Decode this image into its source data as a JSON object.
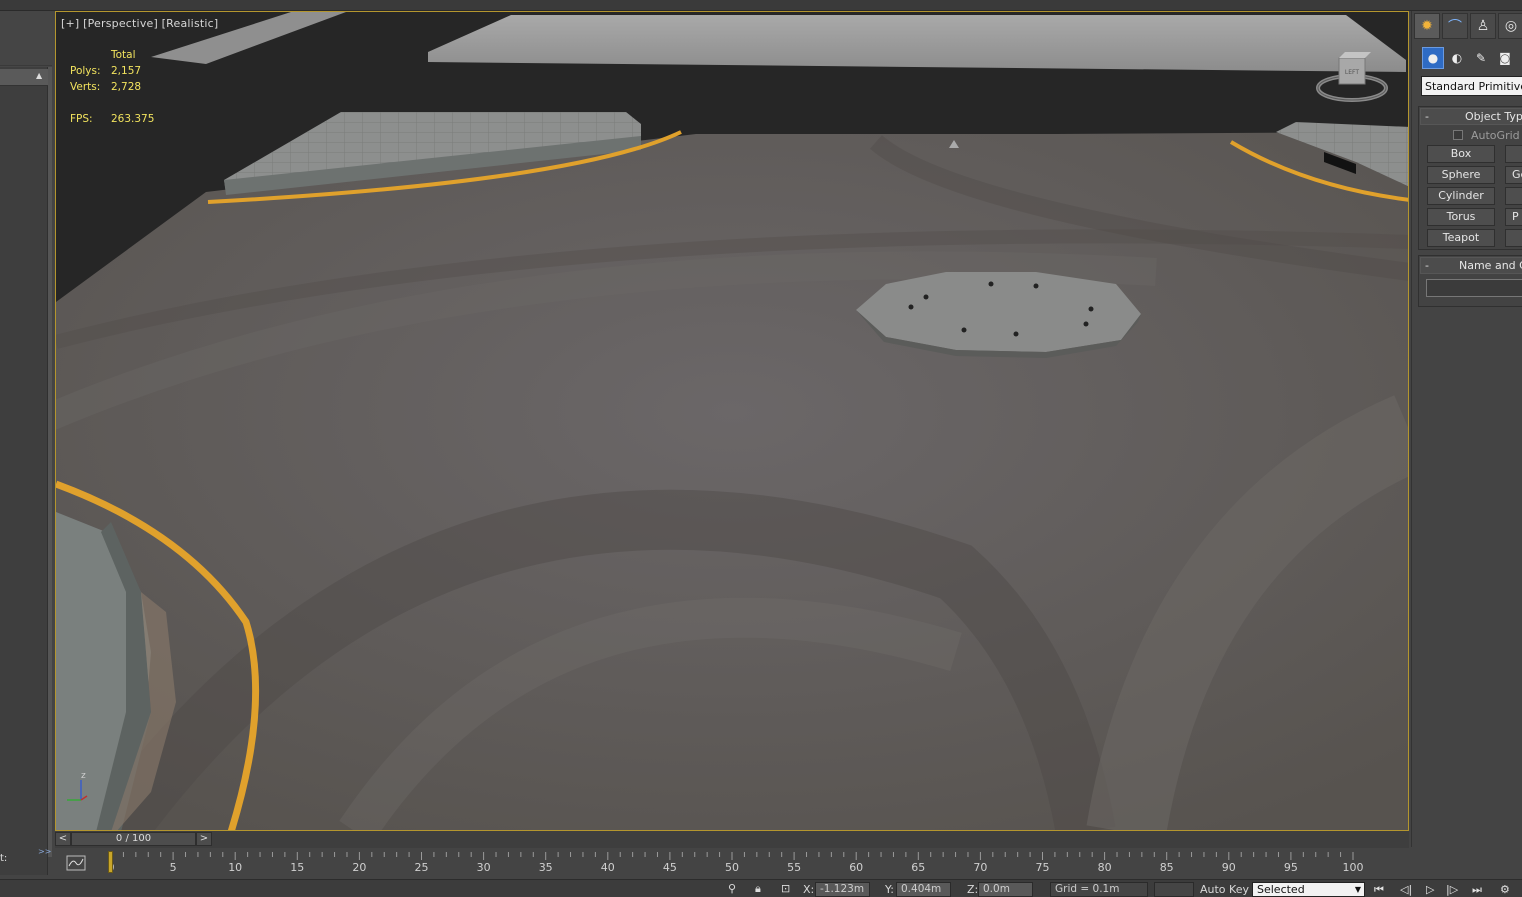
{
  "viewport": {
    "label": "[+] [Perspective] [Realistic]",
    "stats": {
      "header": "Total",
      "polys_label": "Polys:",
      "polys_value": "2,157",
      "verts_label": "Verts:",
      "verts_value": "2,728",
      "fps_label": "FPS:",
      "fps_value": "263.375"
    },
    "viewcube_label": "LEFT",
    "axis_label": "z"
  },
  "left_panel": {
    "bottom_label": "t:",
    "bottom_mark": ">>"
  },
  "command_panel": {
    "tabs": [
      {
        "name": "create",
        "icon": "sun-icon",
        "glyph": "✹"
      },
      {
        "name": "modify",
        "icon": "curve-icon",
        "glyph": "⌒"
      },
      {
        "name": "hierarchy",
        "icon": "hierarchy-icon",
        "glyph": "♙"
      },
      {
        "name": "motion",
        "icon": "motion-icon",
        "glyph": "◎"
      }
    ],
    "subtabs": [
      {
        "name": "geometry",
        "icon": "sphere-icon",
        "glyph": "●"
      },
      {
        "name": "shapes",
        "icon": "shapes-icon",
        "glyph": "◐"
      },
      {
        "name": "lights",
        "icon": "light-icon",
        "glyph": "✎"
      },
      {
        "name": "cameras",
        "icon": "camera-icon",
        "glyph": "◙"
      }
    ],
    "category_dropdown": "Standard Primitives",
    "object_type": {
      "title": "Object Type",
      "collapse_symbol": "-",
      "autogrid_label": "AutoGrid",
      "buttons": [
        "Box",
        "Sphere",
        "Cylinder",
        "Torus",
        "Teapot"
      ],
      "buttons_right": [
        "",
        "Ge",
        "",
        "P",
        ""
      ]
    },
    "name_and_color": {
      "title": "Name and Color",
      "collapse_symbol": "-",
      "name_value": ""
    }
  },
  "time_slider": {
    "prev": "<",
    "position": "0 / 100",
    "next": ">"
  },
  "track_bar": {
    "ticks": [
      "0",
      "5",
      "10",
      "15",
      "20",
      "25",
      "30",
      "35",
      "40",
      "45",
      "50",
      "55",
      "60",
      "65",
      "70",
      "75",
      "80",
      "85",
      "90",
      "95",
      "100"
    ]
  },
  "status_bar": {
    "x_label": "X:",
    "x_value": "-1.123m",
    "y_label": "Y:",
    "y_value": "0.404m",
    "z_label": "Z:",
    "z_value": "0.0m",
    "grid": "Grid = 0.1m",
    "auto_key": "Auto Key",
    "selection_dropdown": "Selected",
    "playback_icons": [
      "go-start-icon",
      "prev-frame-icon",
      "play-icon",
      "next-frame-icon",
      "go-end-icon",
      "key-mode-icon"
    ]
  },
  "colors": {
    "viewport_border": "#b4962e",
    "stats_text": "#f2e35e",
    "road_line": "#e0a12c",
    "active_subtab": "#2e6bc4"
  }
}
